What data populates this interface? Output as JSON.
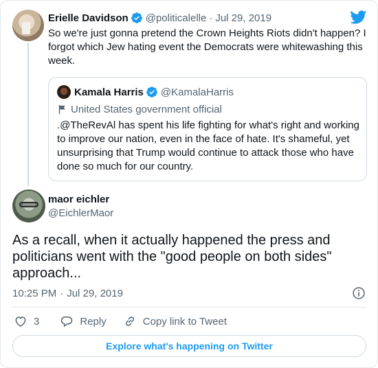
{
  "parent": {
    "name": "Erielle Davidson",
    "handle": "@politicalelle",
    "date": "Jul 29, 2019",
    "text": "So we're just gonna pretend the Crown Heights Riots didn't happen? I forgot which Jew hating event the Democrats were whitewashing this week."
  },
  "quote": {
    "name": "Kamala Harris",
    "handle": "@KamalaHarris",
    "label": "United States government official",
    "text": ".@TheRevAl has spent his life fighting for what's right and working to improve our nation, even in the face of hate. It's shameful, yet unsurprising that Trump would continue to attack those who have done so much for our country."
  },
  "main": {
    "name": "maor eichler",
    "handle": "@EichlerMaor",
    "text": "As a recall, when it actually happened the press and politicians went with the \"good people on both sides\" approach...",
    "time": "10:25 PM",
    "date": "Jul 29, 2019"
  },
  "actions": {
    "like_count": "3",
    "reply_label": "Reply",
    "copy_label": "Copy link to Tweet"
  },
  "explore_label": "Explore what's happening on Twitter",
  "separator": "·",
  "colors": {
    "accent": "#1d9bf0",
    "secondary_text": "#536471",
    "border": "#cfd9de"
  },
  "icons": [
    "verified-badge-icon",
    "twitter-bird-icon",
    "flag-icon",
    "info-icon",
    "heart-icon",
    "reply-icon",
    "link-icon"
  ]
}
